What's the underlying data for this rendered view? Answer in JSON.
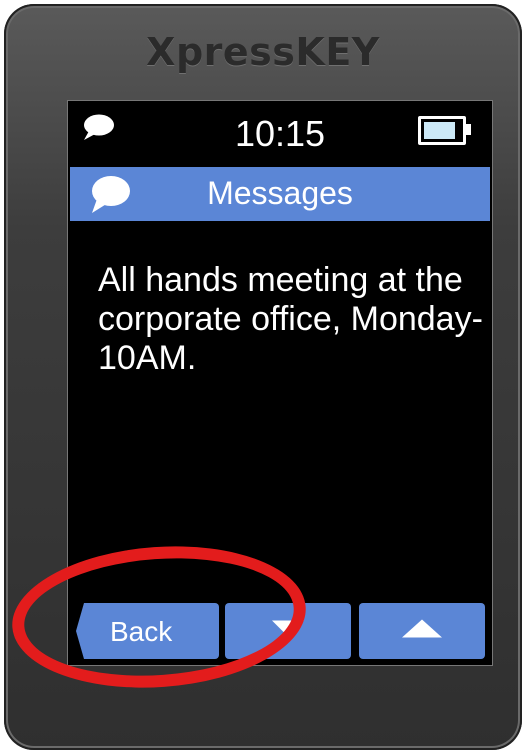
{
  "device": {
    "brand": "XpressKEY"
  },
  "status": {
    "time": "10:15",
    "battery_level": 0.85,
    "icons": [
      "message-bubble-icon",
      "battery-icon"
    ]
  },
  "header": {
    "title": "Messages",
    "icon": "message-bubble-icon",
    "color": "#5b86d6"
  },
  "message": {
    "text": "All hands meeting at the corporate office, Monday- 10AM."
  },
  "nav": {
    "back_label": "Back",
    "down_icon": "arrow-down-icon",
    "up_icon": "arrow-up-icon"
  },
  "colors": {
    "accent": "#5b86d6",
    "screen": "#000000",
    "annotation": "#e31c1c"
  }
}
